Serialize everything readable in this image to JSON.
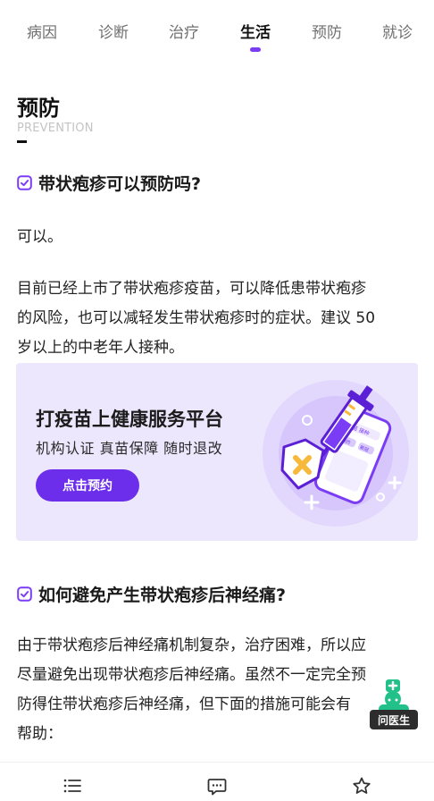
{
  "tabs": [
    {
      "label": "病因"
    },
    {
      "label": "诊断"
    },
    {
      "label": "治疗"
    },
    {
      "label": "生活"
    },
    {
      "label": "预防"
    },
    {
      "label": "就诊"
    }
  ],
  "active_tab": "生活",
  "section": {
    "title": "预防",
    "subtitle": "PREVENTION"
  },
  "q1": {
    "question": "带状疱疹可以预防吗?",
    "answer_short": "可以。",
    "answer_line1": "目前已经上市了带状疱疹疫苗，可以降低患带状疱疹",
    "answer_line2": "的风险，也可以减轻发生带状疱疹时的症状。建议 50",
    "answer_line3": "岁以上的中老年人接种。"
  },
  "banner": {
    "title": "打疫苗上健康服务平台",
    "subtitle": "机构认证  真苗保障  随时退改",
    "button_label": "点击预约",
    "phone_badge_1": "疫苗 接种",
    "phone_badge_2": "预约",
    "phone_badge_3": "新冠"
  },
  "q2": {
    "question": "如何避免产生带状疱疹后神经痛?",
    "line1": "由于带状疱疹后神经痛机制复杂，治疗困难，所以应",
    "line2": "尽量避免出现带状疱疹后神经痛。虽然不一定完全预",
    "line3": "防得住带状疱疹后神经痛，但下面的措施可能会有",
    "line4": "帮助："
  },
  "doctor": {
    "label": "问医生"
  },
  "colors": {
    "accent": "#7b3cf5",
    "button": "#6c2eea",
    "banner_bg": "#ede7fd",
    "doctor_green": "#22c18a"
  },
  "bottom_bar": {
    "icons": [
      "list-icon",
      "chat-icon",
      "star-icon"
    ]
  }
}
